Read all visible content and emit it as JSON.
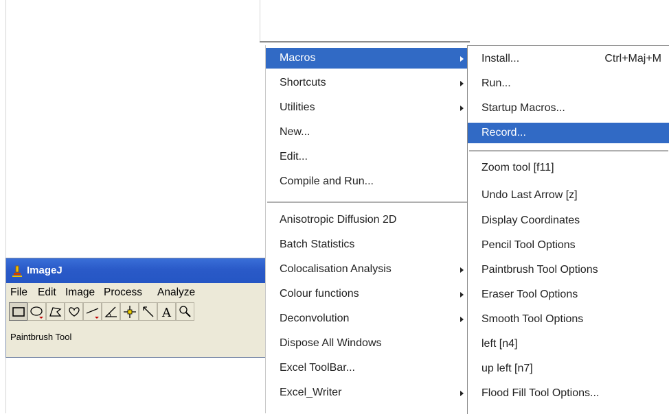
{
  "window": {
    "title": "ImageJ",
    "menubar": [
      "File",
      "Edit",
      "Image",
      "Process",
      "Analyze"
    ],
    "tools": [
      {
        "icon": "rectangle-tool-icon",
        "selected": true
      },
      {
        "icon": "oval-tool-icon"
      },
      {
        "icon": "polygon-tool-icon"
      },
      {
        "icon": "freehand-tool-icon"
      },
      {
        "icon": "straight-line-tool-icon"
      },
      {
        "icon": "angle-tool-icon"
      },
      {
        "icon": "point-tool-icon"
      },
      {
        "icon": "wand-tool-icon"
      },
      {
        "icon": "text-tool-icon"
      },
      {
        "icon": "magnifying-glass-icon"
      }
    ],
    "status": "Paintbrush Tool"
  },
  "plugins_menu": {
    "items": [
      {
        "label": "Macros",
        "submenu": true,
        "highlighted": true
      },
      {
        "label": "Shortcuts",
        "submenu": true
      },
      {
        "label": "Utilities",
        "submenu": true
      },
      {
        "label": "New..."
      },
      {
        "label": "Edit..."
      },
      {
        "label": "Compile and Run..."
      },
      {
        "separator": true
      },
      {
        "label": "Anisotropic Diffusion 2D"
      },
      {
        "label": "Batch Statistics"
      },
      {
        "label": "Colocalisation Analysis",
        "submenu": true
      },
      {
        "label": "Colour functions",
        "submenu": true
      },
      {
        "label": "Deconvolution",
        "submenu": true
      },
      {
        "label": "Dispose All Windows"
      },
      {
        "label": "Excel ToolBar..."
      },
      {
        "label": "Excel_Writer",
        "submenu": true
      }
    ]
  },
  "macros_submenu": {
    "items": [
      {
        "label": "Install...",
        "shortcut": "Ctrl+Maj+M"
      },
      {
        "label": "Run..."
      },
      {
        "label": "Startup Macros..."
      },
      {
        "label": "Record...",
        "highlighted": true
      },
      {
        "separator": true
      },
      {
        "label": "Zoom tool [f11]"
      },
      {
        "label": "Undo Last Arrow [z]"
      },
      {
        "label": "Display Coordinates"
      },
      {
        "label": "Pencil Tool Options"
      },
      {
        "label": "Paintbrush Tool Options"
      },
      {
        "label": "Eraser Tool Options"
      },
      {
        "label": "Smooth Tool Options"
      },
      {
        "label": "left [n4]"
      },
      {
        "label": "up left [n7]"
      },
      {
        "label": "Flood Fill Tool Options..."
      }
    ]
  },
  "colors": {
    "highlight": "#316ac5",
    "titlebar": "#2a5ac8"
  }
}
